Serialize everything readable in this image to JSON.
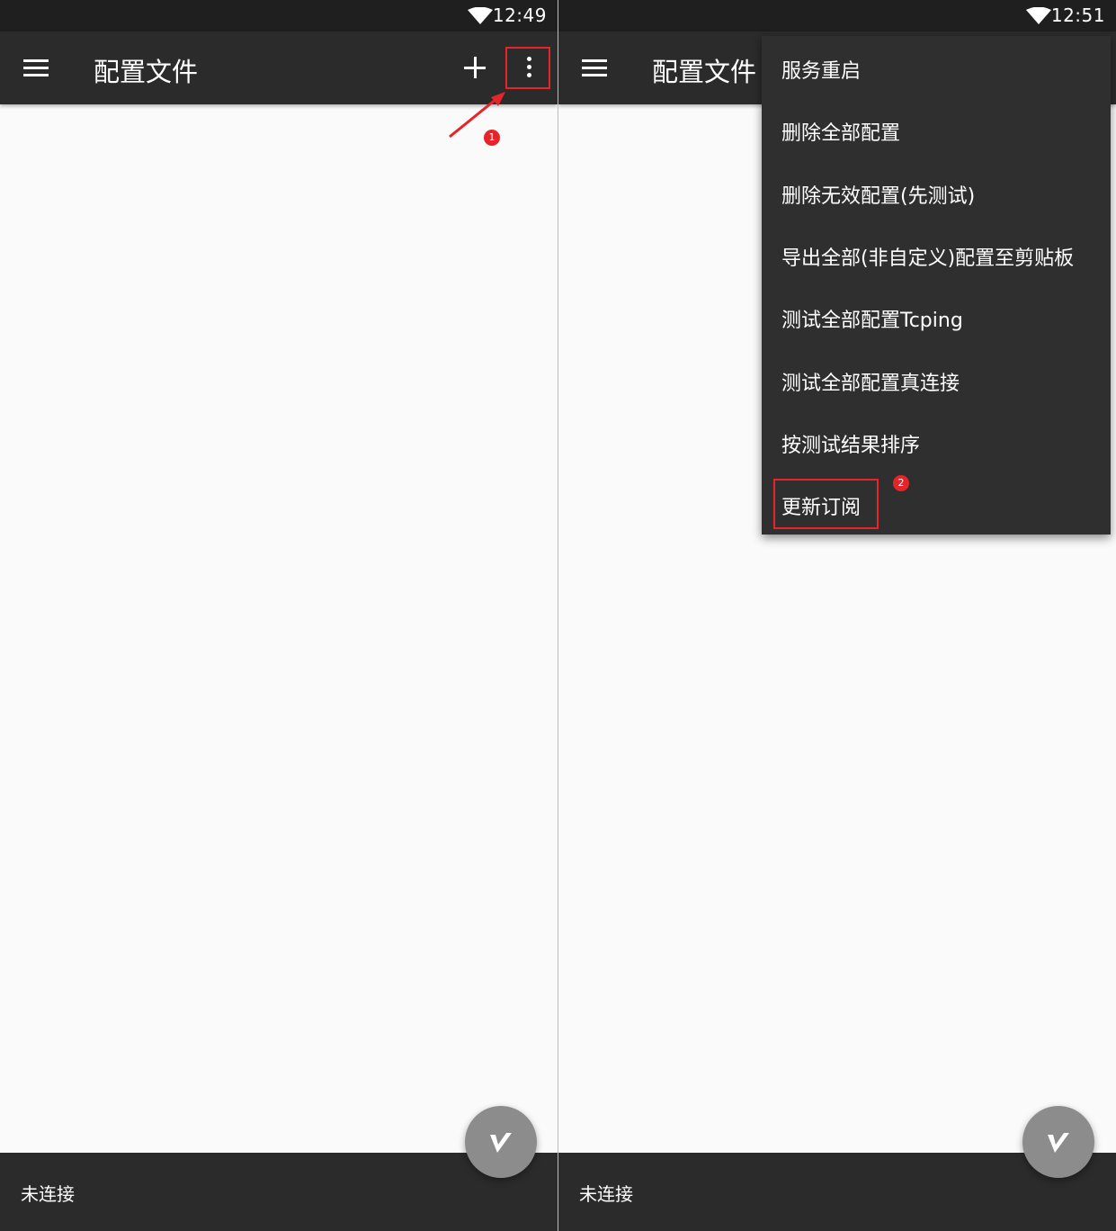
{
  "left": {
    "time": "12:49",
    "title": "配置文件",
    "badge": "1",
    "bottom_status": "未连接"
  },
  "right": {
    "time": "12:51",
    "title": "配置文件",
    "badge": "2",
    "bottom_status": "未连接",
    "menu_items": [
      "服务重启",
      "删除全部配置",
      "删除无效配置(先测试)",
      "导出全部(非自定义)配置至剪贴板",
      "测试全部配置Tcping",
      "测试全部配置真连接",
      "按测试结果排序",
      "更新订阅"
    ]
  },
  "icons": {
    "status": "wifi-icon",
    "navigation": "menu-icon",
    "add": "add-icon",
    "overflow": "more-vert-icon",
    "fab": "v-logo-icon"
  },
  "colors": {
    "toolbar": "#2b2b2b",
    "content": "#fafafa",
    "highlight": "#e5252a",
    "fab": "#8c8c8c"
  }
}
